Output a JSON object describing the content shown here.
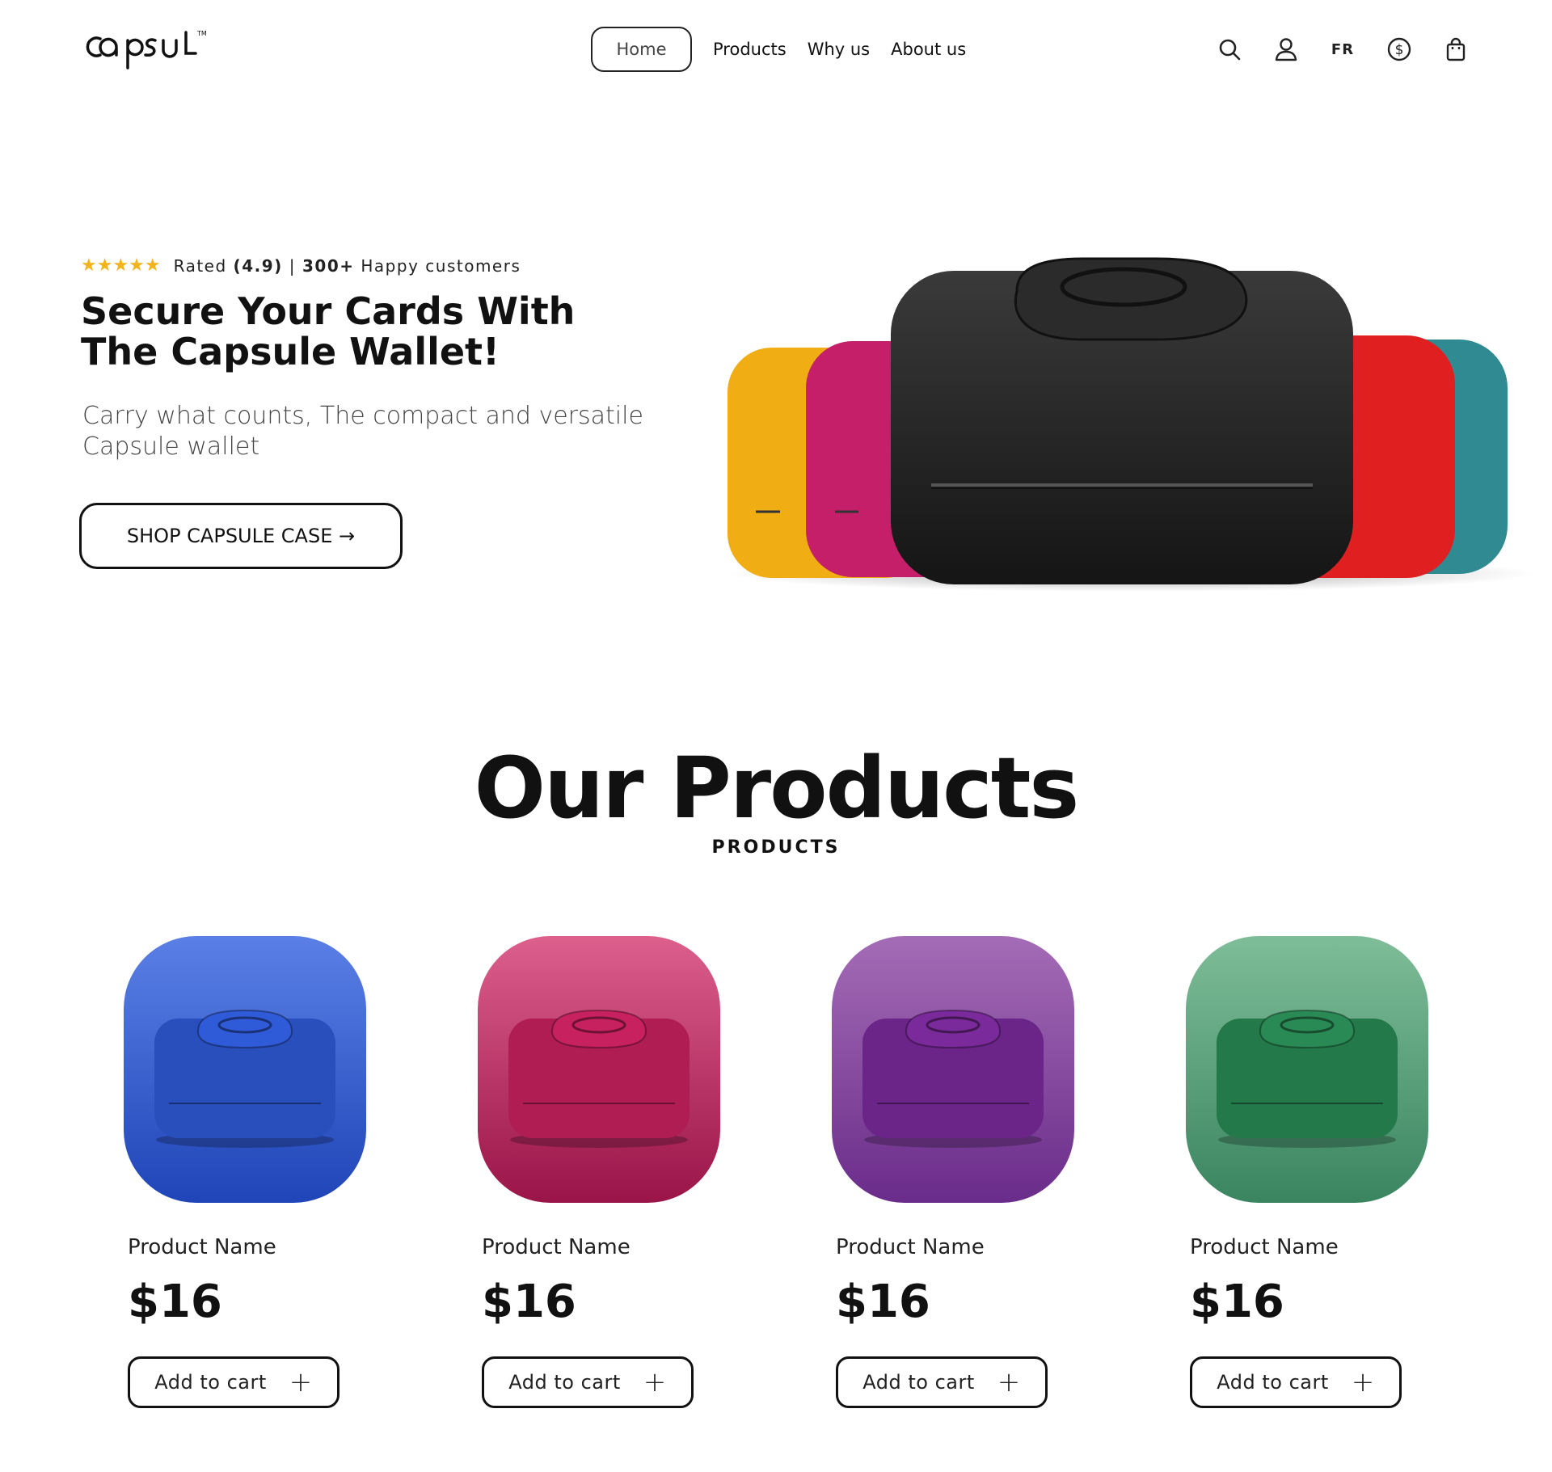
{
  "header": {
    "logo_text": "capsul",
    "nav": [
      {
        "label": "Home",
        "active": true
      },
      {
        "label": "Products"
      },
      {
        "label": "Why us"
      },
      {
        "label": "About us"
      }
    ],
    "icons": [
      "search-icon",
      "user-icon",
      "language-switch",
      "currency-icon",
      "cart-icon"
    ],
    "language": "FR"
  },
  "hero": {
    "stars": "★★★★★",
    "rating_prefix": "Rated",
    "rating_value": "(4.9)",
    "separator": "|",
    "customers_count": "300+",
    "customers_label": "Happy customers",
    "title": "Secure Your Cards With The Capsule Wallet!",
    "subtitle": "Carry what counts, The compact and versatile Capsule wallet",
    "cta_label": "SHOP CAPSULE CASE →",
    "wallet_colors": [
      "#f0ad14",
      "#c41f68",
      "#222222",
      "#e02020",
      "#2f8a92"
    ]
  },
  "products_section": {
    "title": "Our Products",
    "subtitle": "PRODUCTS",
    "items": [
      {
        "name": "Product Name",
        "price": "$16",
        "button": "Add to cart",
        "color": "#2f5ad8",
        "bg_top": "#5a80e6",
        "bg_bottom": "#1f45b8"
      },
      {
        "name": "Product Name",
        "price": "$16",
        "button": "Add to cart",
        "color": "#c8215f",
        "bg_top": "#dc5f8c",
        "bg_bottom": "#9a1448"
      },
      {
        "name": "Product Name",
        "price": "$16",
        "button": "Add to cart",
        "color": "#7a2a9a",
        "bg_top": "#a46cb6",
        "bg_bottom": "#6a2c8a"
      },
      {
        "name": "Product Name",
        "price": "$16",
        "button": "Add to cart",
        "color": "#2a8a55",
        "bg_top": "#7ebd98",
        "bg_bottom": "#3a8560"
      }
    ]
  }
}
